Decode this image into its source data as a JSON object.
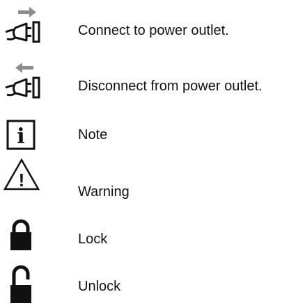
{
  "legend": {
    "items": [
      {
        "icon": "plug-connect-icon",
        "label": "Connect to power outlet."
      },
      {
        "icon": "plug-disconnect-icon",
        "label": "Disconnect from power outlet."
      },
      {
        "icon": "info-note-icon",
        "label": "Note"
      },
      {
        "icon": "warning-triangle-icon",
        "label": "Warning"
      },
      {
        "icon": "lock-closed-icon",
        "label": "Lock"
      },
      {
        "icon": "lock-open-icon",
        "label": "Unlock"
      }
    ]
  },
  "glyphs": {
    "note_letter": "i",
    "warning_mark": "!"
  },
  "colors": {
    "arrow": "#8c8c8c",
    "ink": "#111111"
  }
}
